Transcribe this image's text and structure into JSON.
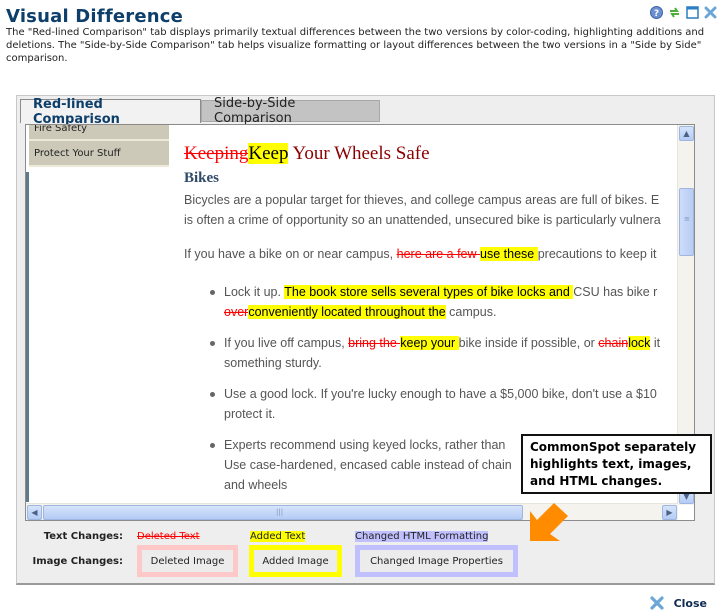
{
  "window": {
    "title": "Visual Difference",
    "icons": [
      "help-icon",
      "refresh-icon",
      "maximize-icon",
      "close-icon"
    ],
    "description": "The \"Red-lined Comparison\" tab displays primarily textual differences between the two versions by color-coding, highlighting additions and deletions. The \"Side-by-Side Comparison\" tab helps visualize formatting or layout differences between the two versions in a \"Side by Side\" comparison."
  },
  "tabs": [
    {
      "label": "Red-lined Comparison",
      "active": true
    },
    {
      "label": "Side-by-Side Comparison",
      "active": false
    }
  ],
  "nav": {
    "items": [
      {
        "label": "Fire Safety"
      },
      {
        "label": "Protect Your Stuff"
      }
    ]
  },
  "article": {
    "heading": {
      "deleted": "Keeping",
      "added": "Keep",
      "rest": " Your Wheels Safe"
    },
    "subheading": "Bikes",
    "paragraph1_line1": "Bicycles are a popular target for thieves, and college campus areas are full of bikes. E",
    "paragraph1_line2": "is often a crime of opportunity so an unattended, unsecured bike is particularly vulnera",
    "paragraph2": {
      "before": "If you have a bike on or near campus, ",
      "deleted": "here are a few ",
      "added": "use these ",
      "after": "precautions to keep it"
    },
    "bullets": [
      {
        "l1_before": "Lock it up. ",
        "l1_added": "The book store sells several types of bike locks and ",
        "l1_after": "CSU has bike r",
        "l2_deleted": "over",
        "l2_added": "conveniently located throughout the",
        "l2_after": " campus."
      },
      {
        "l1_before": "If you live off campus, ",
        "l1_deleted": "bring the ",
        "l1_added": "keep your ",
        "l1_mid": "bike inside if possible, or ",
        "l1_deleted2": "chain",
        "l1_added2": "lock",
        "l1_after": " it",
        "l2": "something sturdy."
      },
      {
        "l1": "Use a good lock. If you're lucky enough to have a $5,000 bike, don't use a $10",
        "l2": "protect it."
      },
      {
        "l1": "Experts recommend using keyed locks, rather than",
        "l2": "Use case-hardened, encased cable instead of chain",
        "l3": "and wheels"
      }
    ]
  },
  "callout": {
    "text": "CommonSpot separately highlights text, images, and HTML changes."
  },
  "legend": {
    "text_changes_label": "Text Changes:",
    "image_changes_label": "Image Changes:",
    "deleted_text": "Deleted Text",
    "added_text": "Added Text",
    "changed_html": "Changed HTML Formatting",
    "deleted_image": "Deleted Image",
    "added_image": "Added Image",
    "changed_image": "Changed Image Properties",
    "colors": {
      "deleted": "#ff0000",
      "deleted_image_border": "#ffc8c8",
      "added": "#ffff00",
      "changed": "#c0c0ff"
    }
  },
  "footer": {
    "close_label": "Close"
  }
}
